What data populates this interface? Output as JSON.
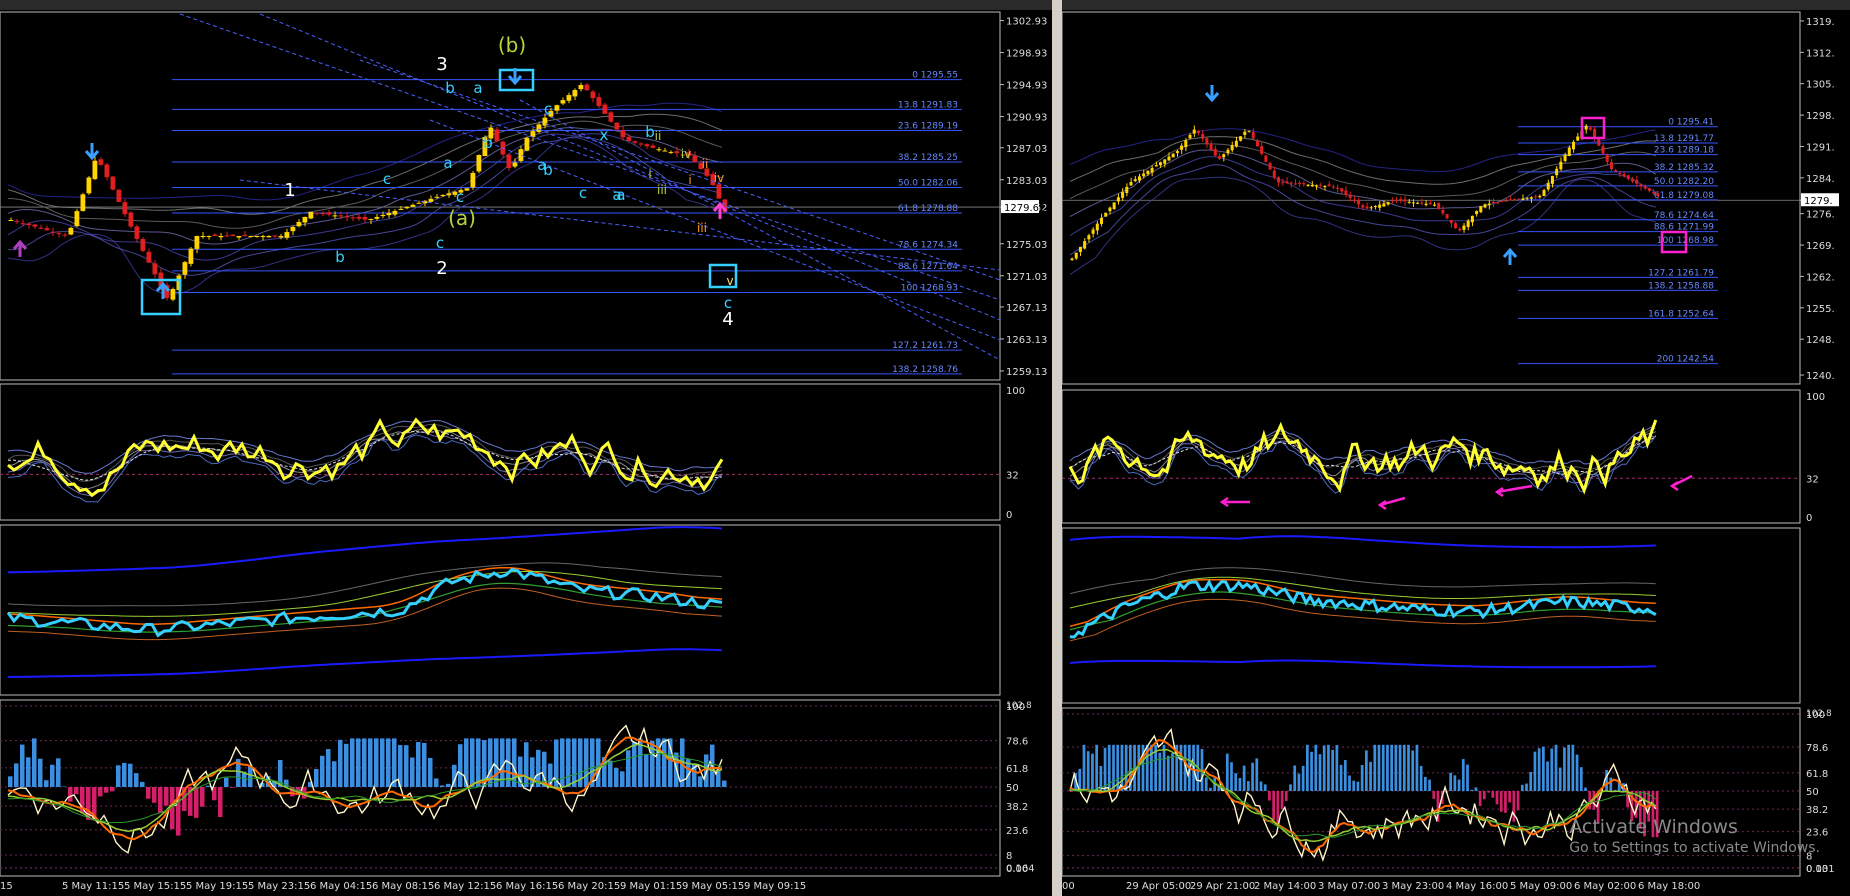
{
  "left": {
    "price_ticks": [
      "1302.93",
      "1298.93",
      "1294.93",
      "1290.93",
      "1287.03",
      "1283.03",
      "1279.62",
      "1275.03",
      "1271.03",
      "1267.13",
      "1263.13",
      "1259.13"
    ],
    "current_price": "1279.62",
    "fib_levels": [
      {
        "label": "0 1295.55",
        "price": 1295.55
      },
      {
        "label": "13.8 1291.83",
        "price": 1291.83
      },
      {
        "label": "23.6 1289.19",
        "price": 1289.19
      },
      {
        "label": "38.2 1285.25",
        "price": 1285.25
      },
      {
        "label": "50.0 1282.06",
        "price": 1282.06
      },
      {
        "label": "61.8 1278.88",
        "price": 1278.88
      },
      {
        "label": "78.6 1274.34",
        "price": 1274.34
      },
      {
        "label": "88.6 1271.64",
        "price": 1271.64
      },
      {
        "label": "100 1268.93",
        "price": 1268.93
      },
      {
        "label": "127.2 1261.73",
        "price": 1261.73
      },
      {
        "label": "138.2 1258.76",
        "price": 1258.76
      }
    ],
    "wave_labels_white": [
      "3",
      "1",
      "2",
      "4"
    ],
    "wave_labels_green": [
      "(b)",
      "(a)"
    ],
    "wave_labels_cyan": [
      "b",
      "a",
      "c",
      "b",
      "a",
      "c",
      "b",
      "c",
      "a",
      "x",
      "b",
      "a",
      "c",
      "b",
      "a",
      "c",
      "c"
    ],
    "wave_labels_small": [
      "ii",
      "iv",
      "i",
      "iii",
      "v",
      "iii",
      "iv",
      "ii",
      "i"
    ],
    "rsi_ticks": [
      "100",
      "32",
      "0"
    ],
    "osc_ticks": [
      "100",
      "78.6",
      "61.8",
      "50",
      "0.00",
      "38.2",
      "23.6",
      "8",
      "0.164"
    ],
    "osc_top_label": "102.8",
    "time_labels": [
      "15",
      "5 May 11:15",
      "5 May 15:15",
      "5 May 19:15",
      "5 May 23:15",
      "6 May 04:15",
      "6 May 08:15",
      "6 May 12:15",
      "6 May 16:15",
      "6 May 20:15",
      "9 May 01:15",
      "9 May 05:15",
      "9 May 09:15"
    ]
  },
  "right": {
    "price_ticks": [
      "1319.",
      "1312.",
      "1305.",
      "1298.",
      "1291.",
      "1284.",
      "1279.",
      "1276.",
      "1269.",
      "1262.",
      "1255.",
      "1248.",
      "1240."
    ],
    "current_price": "1279.",
    "fib_levels": [
      {
        "label": "0 1295.41",
        "price": 1295.41
      },
      {
        "label": "13.8 1291.77",
        "price": 1291.77
      },
      {
        "label": "23.6 1289.18",
        "price": 1289.18
      },
      {
        "label": "38.2 1285.32",
        "price": 1285.32
      },
      {
        "label": "50.0 1282.20",
        "price": 1282.2
      },
      {
        "label": "61.8 1279.08",
        "price": 1279.08
      },
      {
        "label": "78.6 1274.64",
        "price": 1274.64
      },
      {
        "label": "88.6 1271.99",
        "price": 1271.99
      },
      {
        "label": "100 1268.98",
        "price": 1268.98
      },
      {
        "label": "127.2 1261.79",
        "price": 1261.79
      },
      {
        "label": "138.2 1258.88",
        "price": 1258.88
      },
      {
        "label": "161.8 1252.64",
        "price": 1252.64
      },
      {
        "label": "200 1242.54",
        "price": 1242.54
      }
    ],
    "rsi_ticks": [
      "100",
      "32",
      "0"
    ],
    "osc_ticks": [
      "100",
      "78.6",
      "61.8",
      "50",
      "0.00",
      "38.2",
      "23.6",
      "8",
      "0.131"
    ],
    "osc_top_label": "102.8",
    "time_labels": [
      "00",
      "29 Apr 05:00",
      "29 Apr 21:00",
      "2 May 14:00",
      "3 May 07:00",
      "3 May 23:00",
      "4 May 16:00",
      "5 May 09:00",
      "6 May 02:00",
      "6 May 18:00"
    ]
  },
  "watermark": {
    "line1": "Activate Windows",
    "line2": "Go to Settings to activate Windows."
  },
  "colors": {
    "bull": "#ffd400",
    "bear": "#e02020",
    "fib": "#3355ff",
    "cyan": "#35d0ff",
    "rsi": "#ffff33",
    "magenta": "#ff1fd0",
    "green": "#9acd32",
    "hist_pos": "#3b8fe0",
    "hist_neg": "#d4206a"
  }
}
